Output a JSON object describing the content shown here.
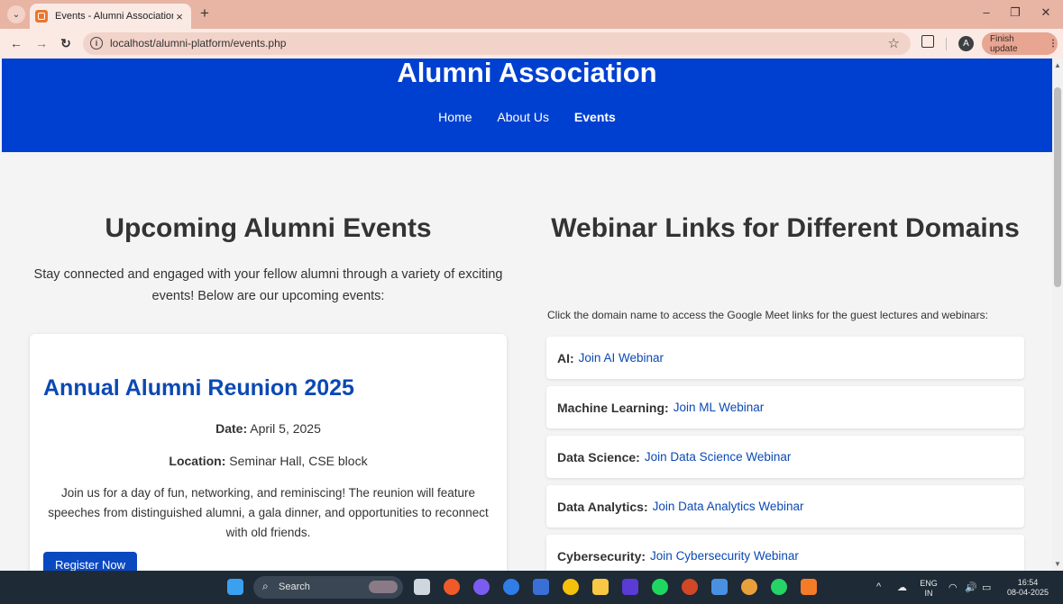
{
  "browser": {
    "tab_title": "Events - Alumni Association",
    "tab_close": "×",
    "new_tab": "+",
    "url": "localhost/alumni-platform/events.php",
    "finish_update": "Finish update",
    "avatar_letter": "A"
  },
  "site": {
    "title": "Alumni Association",
    "nav": [
      "Home",
      "About Us",
      "Events"
    ],
    "active_nav": "Events"
  },
  "events_section": {
    "title": "Upcoming Alumni Events",
    "intro": "Stay connected and engaged with your fellow alumni through a variety of exciting events! Below are our upcoming events:",
    "event": {
      "title": "Annual Alumni Reunion 2025",
      "date_label": "Date:",
      "date_value": "April 5, 2025",
      "location_label": "Location:",
      "location_value": "Seminar Hall, CSE block",
      "description": "Join us for a day of fun, networking, and reminiscing! The reunion will feature speeches from distinguished alumni, a gala dinner, and opportunities to reconnect with old friends.",
      "register_label": "Register Now"
    }
  },
  "webinar_section": {
    "title": "Webinar Links for Different Domains",
    "intro": "Click the domain name to access the Google Meet links for the guest lectures and webinars:",
    "domains": [
      {
        "name": "AI:",
        "link": "Join AI Webinar"
      },
      {
        "name": "Machine Learning:",
        "link": "Join ML Webinar"
      },
      {
        "name": "Data Science:",
        "link": "Join Data Science Webinar"
      },
      {
        "name": "Data Analytics:",
        "link": "Join Data Analytics Webinar"
      },
      {
        "name": "Cybersecurity:",
        "link": "Join Cybersecurity Webinar"
      }
    ]
  },
  "taskbar": {
    "search_label": "Search",
    "language_line1": "ENG",
    "language_line2": "IN",
    "time": "16:54",
    "date": "08-04-2025"
  }
}
